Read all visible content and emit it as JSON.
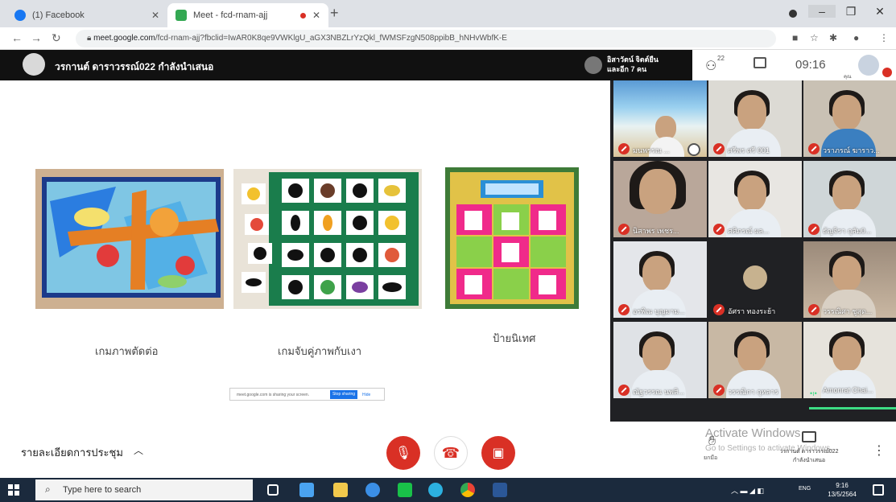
{
  "browser": {
    "tabs": [
      {
        "title": "(1) Facebook",
        "active": false,
        "favicon_color": "#1877f2"
      },
      {
        "title": "Meet - fcd-rnam-ajj",
        "active": true,
        "favicon_color": "#34a853"
      }
    ],
    "address": {
      "host": "meet.google.com",
      "path": "/fcd-rnam-ajj?fbclid=IwAR0K8qe9VWKlgU_aGX3NBZLrYzQkl_fWMSFzgN508ppibB_hNHvWbfK-E"
    }
  },
  "meet_header": {
    "presenter_title": "วรกานต์ ดาราวรรณ์022 กำลังนำเสนอ",
    "pinned_line1": "อิสาวัตน์ จิตต์ยืน",
    "pinned_line2": "และอีก 7 คน",
    "people_count": "22",
    "clock": "09:16",
    "self_label": "คุณ"
  },
  "presentation": {
    "captions": [
      "เกมภาพตัดต่อ",
      "เกมจับคู่ภาพกับเงา",
      "ป้ายนิเทศ"
    ],
    "share_bar": {
      "text": "meet.google.com is sharing your screen.",
      "stop_label": "Stop sharing",
      "hide_label": "Hide"
    }
  },
  "participants": [
    {
      "name": "มนพรรณ ..."
    },
    {
      "name": "ศรีพร ศรี 001"
    },
    {
      "name": "วราภรณ์ ฆาราว..."
    },
    {
      "name": "นิสาพร เพชร..."
    },
    {
      "name": "ศศิภรณ์ ผล..."
    },
    {
      "name": "ธัญจิรา กุสัม0..."
    },
    {
      "name": "อรพิณ บุญมาม..."
    },
    {
      "name": "อัศรา ทองระย้า"
    },
    {
      "name": "วรรณิศา ชูสุด..."
    },
    {
      "name": "ณัฐวรรณ นพสิ..."
    },
    {
      "name": "วรรณิกา กุหลาร"
    },
    {
      "name": "Amonrat Chai..."
    }
  ],
  "controls": {
    "meeting_details": "รายละเอียดการประชุม",
    "hand_label": "ยกมือ",
    "present_line1": "วรกานต์ ดาราวรรณ์022",
    "present_line2": "กำลังนำเสนอ",
    "activate_title": "Activate Windows",
    "activate_sub": "Go to Settings to activate Windows."
  },
  "taskbar": {
    "search_placeholder": "Type here to search",
    "lang": "ENG",
    "time": "9:16",
    "date": "13/5/2564"
  },
  "colors": {
    "meet_red": "#d93025",
    "meet_dark": "#202124",
    "taskbar": "#1b2a3d",
    "active_speaker": "#3ddc84"
  }
}
